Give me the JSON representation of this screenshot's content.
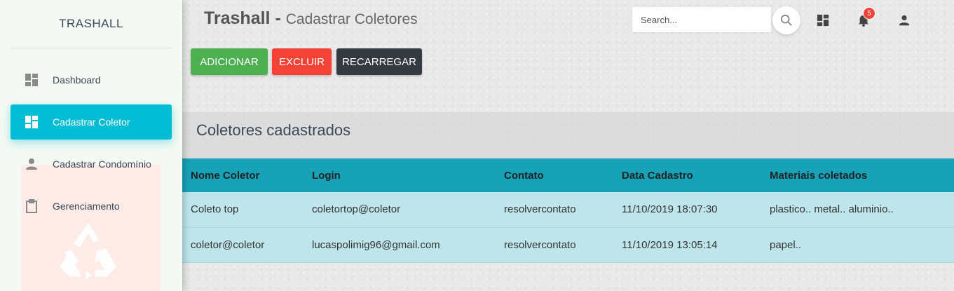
{
  "sidebar": {
    "brand": "TRASHALL",
    "items": [
      {
        "label": "Dashboard",
        "icon": "dashboard-icon",
        "active": false
      },
      {
        "label": "Cadastrar Coletor",
        "icon": "dashboard-icon",
        "active": true
      },
      {
        "label": "Cadastrar Condomínio",
        "icon": "person-icon",
        "active": false
      },
      {
        "label": "Gerenciamento",
        "icon": "clipboard-icon",
        "active": false
      }
    ]
  },
  "header": {
    "title": "Trashall -",
    "subtitle": "Cadastrar Coletores",
    "search_placeholder": "Search...",
    "notification_count": "5"
  },
  "actions": {
    "add": "ADICIONAR",
    "delete": "EXCLUIR",
    "reload": "RECARREGAR"
  },
  "table": {
    "title": "Coletores cadastrados",
    "columns": [
      "Nome Coletor",
      "Login",
      "Contato",
      "Data Cadastro",
      "Materiais coletados"
    ],
    "rows": [
      [
        "Coleto top",
        "coletortop@coletor",
        "resolvercontato",
        "11/10/2019 18:07:30",
        "plastico.. metal.. aluminio.."
      ],
      [
        "coletor@coletor",
        "lucaspolimig96@gmail.com",
        "resolvercontato",
        "11/10/2019 13:05:14",
        "papel.."
      ]
    ]
  },
  "colors": {
    "active_nav": "#00bcd4",
    "add": "#4caf50",
    "delete": "#f44336",
    "reload": "#343a40",
    "table_header": "#17a2b8",
    "table_row": "#bee5eb",
    "badge": "#f44336"
  }
}
